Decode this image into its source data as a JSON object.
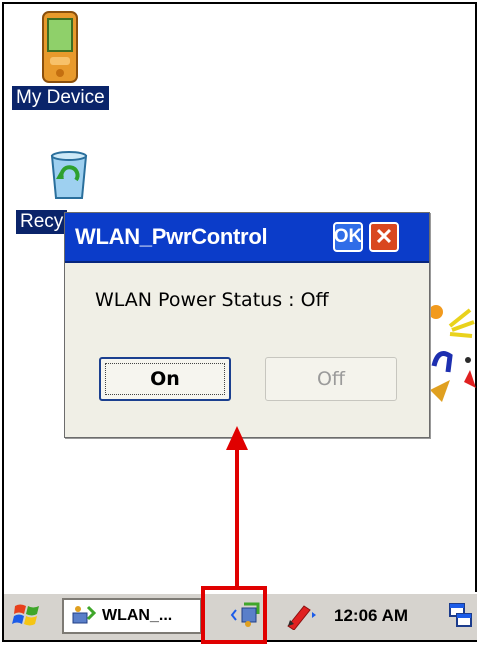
{
  "desktop": {
    "icons": [
      {
        "label": "My Device",
        "icon": "pda-icon"
      },
      {
        "label": "Recy",
        "icon": "recycle-bin-icon"
      }
    ]
  },
  "dialog": {
    "title": "WLAN_PwrControl",
    "ok_label": "OK",
    "close_label": "✕",
    "status_text": "WLAN Power Status : Off",
    "on_label": "On",
    "off_label": "Off"
  },
  "taskbar": {
    "task_label": "WLAN_...",
    "clock": "12:06 AM"
  },
  "colors": {
    "titlebar": "#0b3cc9",
    "annotation": "#e00000",
    "selection": "#0a246a"
  }
}
